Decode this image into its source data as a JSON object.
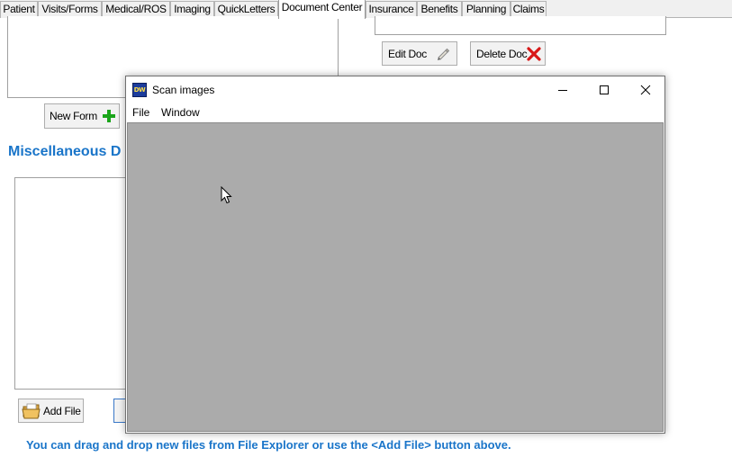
{
  "tabs": [
    {
      "label": "Patient",
      "active": false
    },
    {
      "label": "Visits/Forms",
      "active": false
    },
    {
      "label": "Medical/ROS",
      "active": false
    },
    {
      "label": "Imaging",
      "active": false
    },
    {
      "label": "QuickLetters",
      "active": false
    },
    {
      "label": "Document Center",
      "active": true
    },
    {
      "label": "Insurance",
      "active": false
    },
    {
      "label": "Benefits",
      "active": false
    },
    {
      "label": "Planning",
      "active": false
    },
    {
      "label": "Claims",
      "active": false
    }
  ],
  "buttons": {
    "new_form": "New Form",
    "edit_doc": "Edit Doc",
    "delete_doc": "Delete Doc",
    "add_file": "Add File"
  },
  "section_title": "Miscellaneous D",
  "hint_text": "You can drag and drop new files from File Explorer or use the <Add File> button above.",
  "dialog": {
    "icon_text": "DW",
    "title": "Scan images",
    "menu": [
      "File",
      "Window"
    ]
  },
  "colors": {
    "accent_text": "#1a75c9",
    "dialog_client": "#ababab",
    "add_icon": "#1aa51a",
    "delete_icon": "#d81818"
  },
  "icons": {
    "new_form": "plus-icon",
    "edit_doc": "pencil-icon",
    "delete_doc": "close-x-icon",
    "add_file": "folder-icon"
  }
}
